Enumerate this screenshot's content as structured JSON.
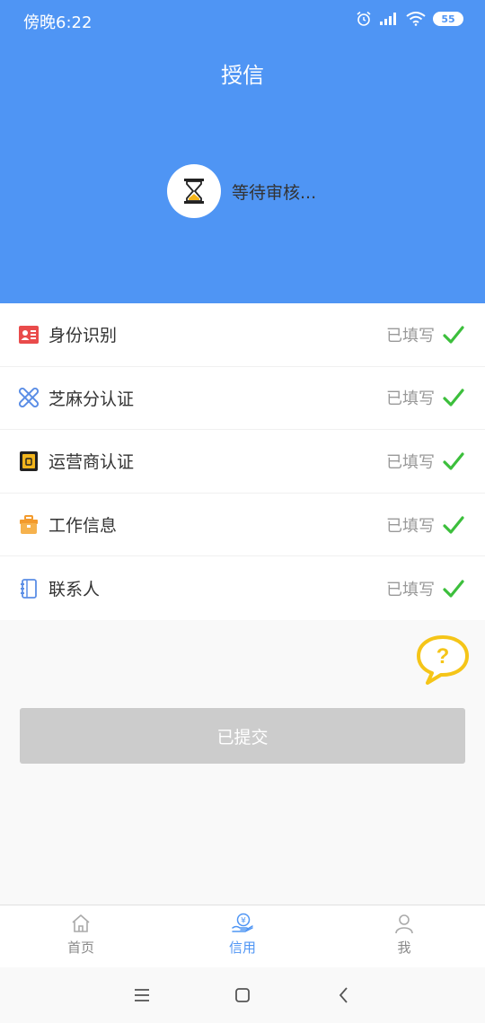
{
  "status_bar": {
    "time": "傍晚6:22",
    "battery": "55",
    "icons": [
      "alarm-icon",
      "signal-icon",
      "wifi-icon",
      "battery-icon"
    ]
  },
  "header": {
    "title": "授信",
    "pending_text": "等待审核..."
  },
  "items": [
    {
      "label": "身份识别",
      "status": "已填写",
      "icon": "id-card-icon",
      "icon_color": "#e94b4b"
    },
    {
      "label": "芝麻分认证",
      "status": "已填写",
      "icon": "sesame-icon",
      "icon_color": "#5b8ee6"
    },
    {
      "label": "运营商认证",
      "status": "已填写",
      "icon": "phone-operator-icon",
      "icon_color": "#f2b51d"
    },
    {
      "label": "工作信息",
      "status": "已填写",
      "icon": "briefcase-icon",
      "icon_color": "#f39a2c"
    },
    {
      "label": "联系人",
      "status": "已填写",
      "icon": "contacts-book-icon",
      "icon_color": "#5b8ee6"
    }
  ],
  "submit_button": {
    "label": "已提交"
  },
  "tabs": [
    {
      "label": "首页",
      "icon": "home-icon",
      "active": false
    },
    {
      "label": "信用",
      "icon": "credit-icon",
      "active": true
    },
    {
      "label": "我",
      "icon": "user-icon",
      "active": false
    }
  ],
  "colors": {
    "primary": "#4f95f4",
    "check": "#3cbf3c",
    "disabled": "#cccccc",
    "help_bubble": "#f5c518"
  }
}
